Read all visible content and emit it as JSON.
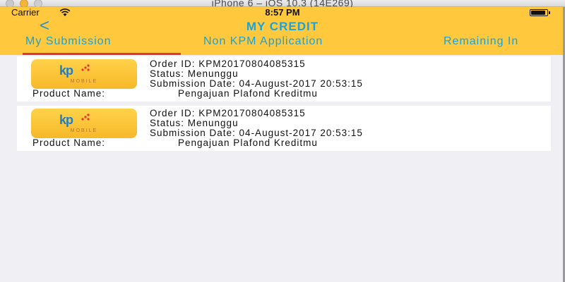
{
  "window": {
    "title": "iPhone 6 – iOS 10.3 (14E269)"
  },
  "status_bar": {
    "carrier": "Carrier",
    "time": "8:57 PM",
    "battery_level": 0.9
  },
  "nav": {
    "back_glyph": "<",
    "title": "MY CREDIT"
  },
  "tabs": [
    {
      "label": "My Submission",
      "selected": true
    },
    {
      "label": "Non KPM Application",
      "selected": false
    },
    {
      "label": "Remaining In",
      "selected": false
    }
  ],
  "colors": {
    "header_bg": "#ffc83d",
    "accent_text": "#1aa3d6",
    "tab_indicator": "#e3342f"
  },
  "submissions": [
    {
      "logo_text": "kp",
      "logo_sub": "MOBILE",
      "order_id": "Order ID: KPM20170804085315",
      "status": "Status: Menunggu",
      "submission_date": "Submission Date: 04-August-2017 20:53:15",
      "product_label": "Product Name:",
      "product_value": "Pengajuan Plafond Kreditmu"
    },
    {
      "logo_text": "kp",
      "logo_sub": "MOBILE",
      "order_id": "Order ID: KPM20170804085315",
      "status": "Status: Menunggu",
      "submission_date": "Submission Date: 04-August-2017 20:53:15",
      "product_label": "Product Name:",
      "product_value": "Pengajuan Plafond Kreditmu"
    }
  ]
}
